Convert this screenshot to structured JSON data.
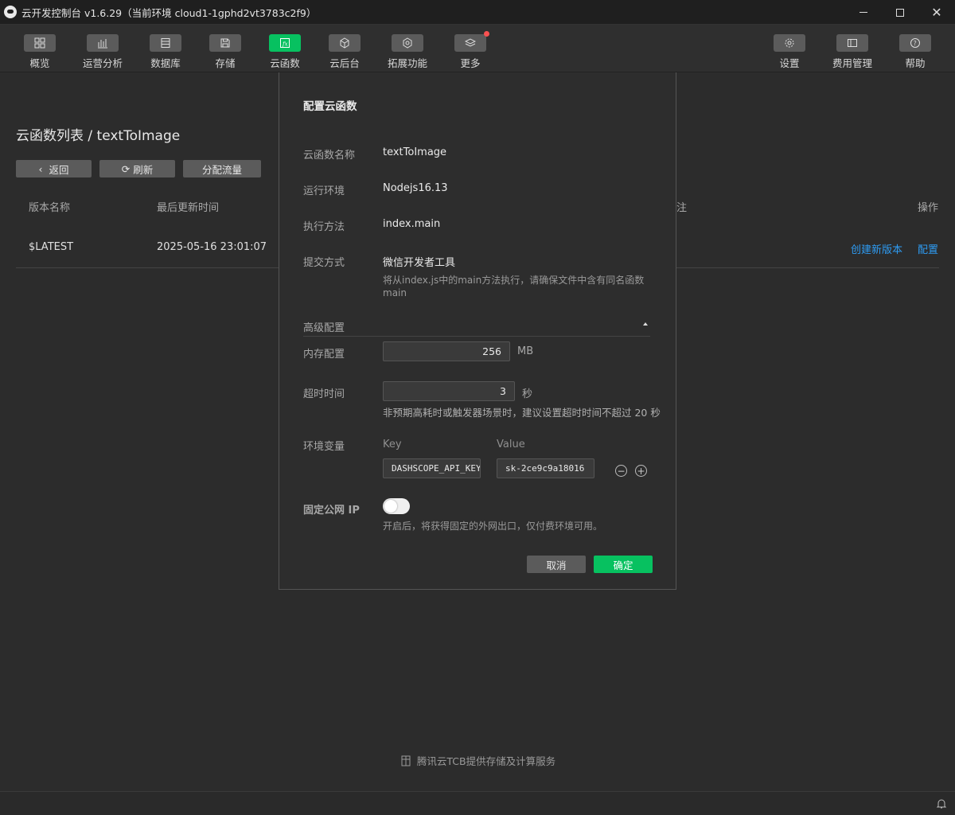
{
  "window": {
    "title": "云开发控制台 v1.6.29（当前环境 cloud1-1gphd2vt3783c2f9）"
  },
  "toolbar": {
    "items": [
      {
        "label": "概览",
        "icon": "grid-icon"
      },
      {
        "label": "运营分析",
        "icon": "bar-chart-icon"
      },
      {
        "label": "数据库",
        "icon": "database-icon"
      },
      {
        "label": "存储",
        "icon": "save-icon"
      },
      {
        "label": "云函数",
        "icon": "function-icon",
        "active": true
      },
      {
        "label": "云后台",
        "icon": "cube-icon"
      },
      {
        "label": "拓展功能",
        "icon": "extension-icon"
      },
      {
        "label": "更多",
        "icon": "layers-icon"
      },
      {
        "label": "设置",
        "icon": "gear-icon"
      },
      {
        "label": "费用管理",
        "icon": "billing-icon"
      },
      {
        "label": "帮助",
        "icon": "help-icon"
      }
    ],
    "accent": "#07c160",
    "badge_color": "#fa5151"
  },
  "main": {
    "title": "云函数列表 / textToImage",
    "buttons": {
      "back": "返回",
      "refresh": "刷新",
      "traffic": "分配流量"
    },
    "columns": {
      "version": "版本名称",
      "updated": "最后更新时间",
      "note": "注",
      "action": "操作"
    },
    "rows": [
      {
        "version": "$LATEST",
        "updated": "2025-05-16 23:01:07",
        "create_version": "创建新版本",
        "configure": "配置"
      }
    ],
    "link_color": "#2e9bf2"
  },
  "modal": {
    "title": "配置云函数",
    "function_name_label": "云函数名称",
    "function_name": "textToImage",
    "runtime_label": "运行环境",
    "runtime": "Nodejs16.13",
    "handler_label": "执行方法",
    "handler": "index.main",
    "submit_label": "提交方式",
    "submit_method": "微信开发者工具",
    "submit_help_line1": "将从index.js中的main方法执行，请确保文件中含有同名函数",
    "submit_help_line2": "main",
    "advanced_label": "高级配置",
    "memory_label": "内存配置",
    "memory_value": "256",
    "memory_unit": "MB",
    "timeout_label": "超时时间",
    "timeout_value": "3",
    "timeout_unit": "秒",
    "timeout_help": "非预期高耗时或触发器场景时，建议设置超时时间不超过 20 秒",
    "env_label": "环境变量",
    "env_key_header": "Key",
    "env_value_header": "Value",
    "env_key": "DASHSCOPE_API_KEY",
    "env_value": "sk-2ce9c9a18016",
    "fixed_ip_label": "固定公网 IP",
    "fixed_ip_on": false,
    "fixed_ip_help": "开启后，将获得固定的外网出口，仅付费环境可用。",
    "cancel": "取消",
    "ok": "确定"
  },
  "footer": {
    "text": "腾讯云TCB提供存储及计算服务"
  }
}
